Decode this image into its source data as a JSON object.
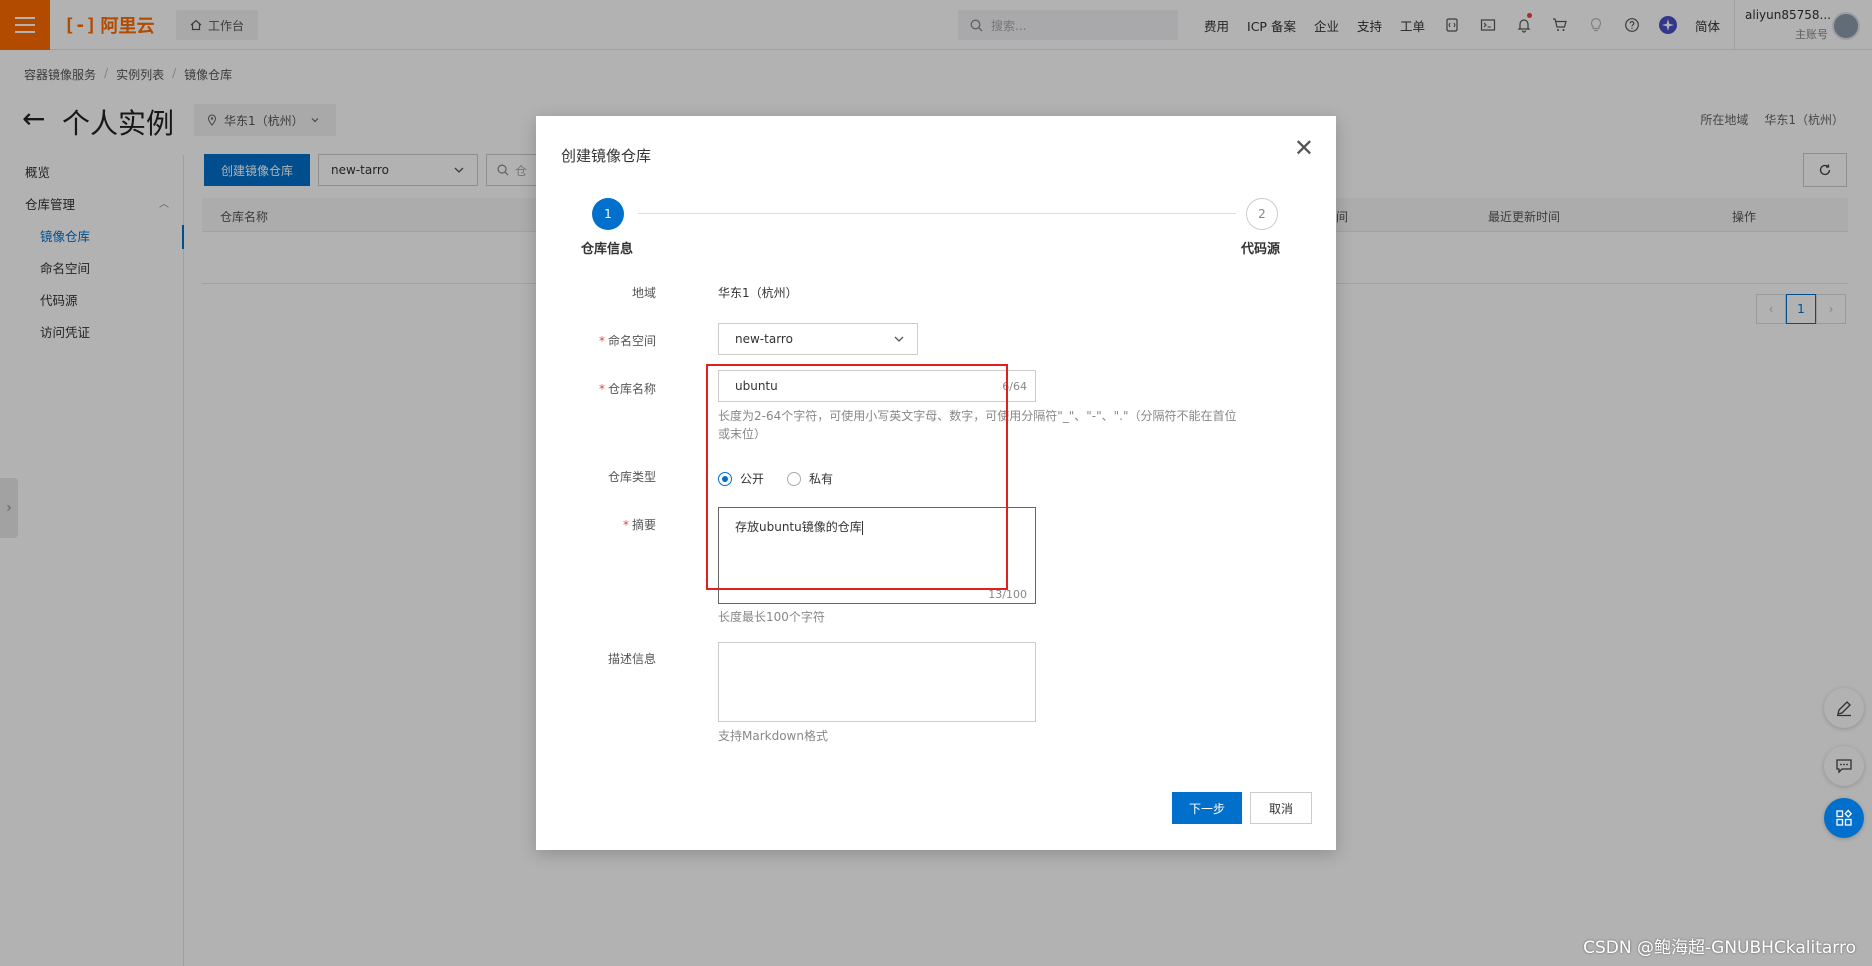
{
  "topbar": {
    "logo_text": "阿里云",
    "workbench": "工作台",
    "search_placeholder": "搜索...",
    "links": [
      "费用",
      "ICP 备案",
      "企业",
      "支持",
      "工单"
    ],
    "lang": "简体",
    "account_name": "aliyun85758...",
    "account_role": "主账号"
  },
  "breadcrumb": [
    "容器镜像服务",
    "实例列表",
    "镜像仓库"
  ],
  "page": {
    "title": "个人实例",
    "region": "华东1（杭州）",
    "region_label_right": "所在地域",
    "region_value_right": "华东1（杭州）"
  },
  "sidebar": {
    "items": [
      {
        "label": "概览"
      },
      {
        "label": "仓库管理"
      },
      {
        "label": "镜像仓库"
      },
      {
        "label": "命名空间"
      },
      {
        "label": "代码源"
      },
      {
        "label": "访问凭证"
      }
    ]
  },
  "content": {
    "create_button": "创建镜像仓库",
    "namespace_filter": "new-tarro",
    "search_placeholder": "仓",
    "table_headers": [
      "仓库名称",
      "间",
      "最近更新时间",
      "操作"
    ],
    "current_page": "1"
  },
  "modal": {
    "title": "创建镜像仓库",
    "steps": [
      {
        "number": "1",
        "label": "仓库信息"
      },
      {
        "number": "2",
        "label": "代码源"
      }
    ],
    "region_label": "地域",
    "region_value": "华东1（杭州）",
    "namespace_label": "命名空间",
    "namespace_value": "new-tarro",
    "repo_name_label": "仓库名称",
    "repo_name_value": "ubuntu",
    "repo_name_counter": "6/64",
    "repo_name_hint": "长度为2-64个字符，可使用小写英文字母、数字，可使用分隔符\"_\"、\"-\"、\".\"（分隔符不能在首位或末位）",
    "repo_type_label": "仓库类型",
    "repo_type_options": [
      "公开",
      "私有"
    ],
    "repo_type_selected": "公开",
    "summary_label": "摘要",
    "summary_value": "存放ubuntu镜像的仓库",
    "summary_counter": "13/100",
    "summary_hint": "长度最长100个字符",
    "desc_label": "描述信息",
    "desc_value": "",
    "desc_hint": "支持Markdown格式",
    "next_button": "下一步",
    "cancel_button": "取消"
  },
  "watermark": "CSDN @鲍海超-GNUBHCkalitarro",
  "colors": {
    "brand_orange": "#ff6a00",
    "primary_blue": "#0070cc",
    "highlight_red": "#e02020"
  }
}
